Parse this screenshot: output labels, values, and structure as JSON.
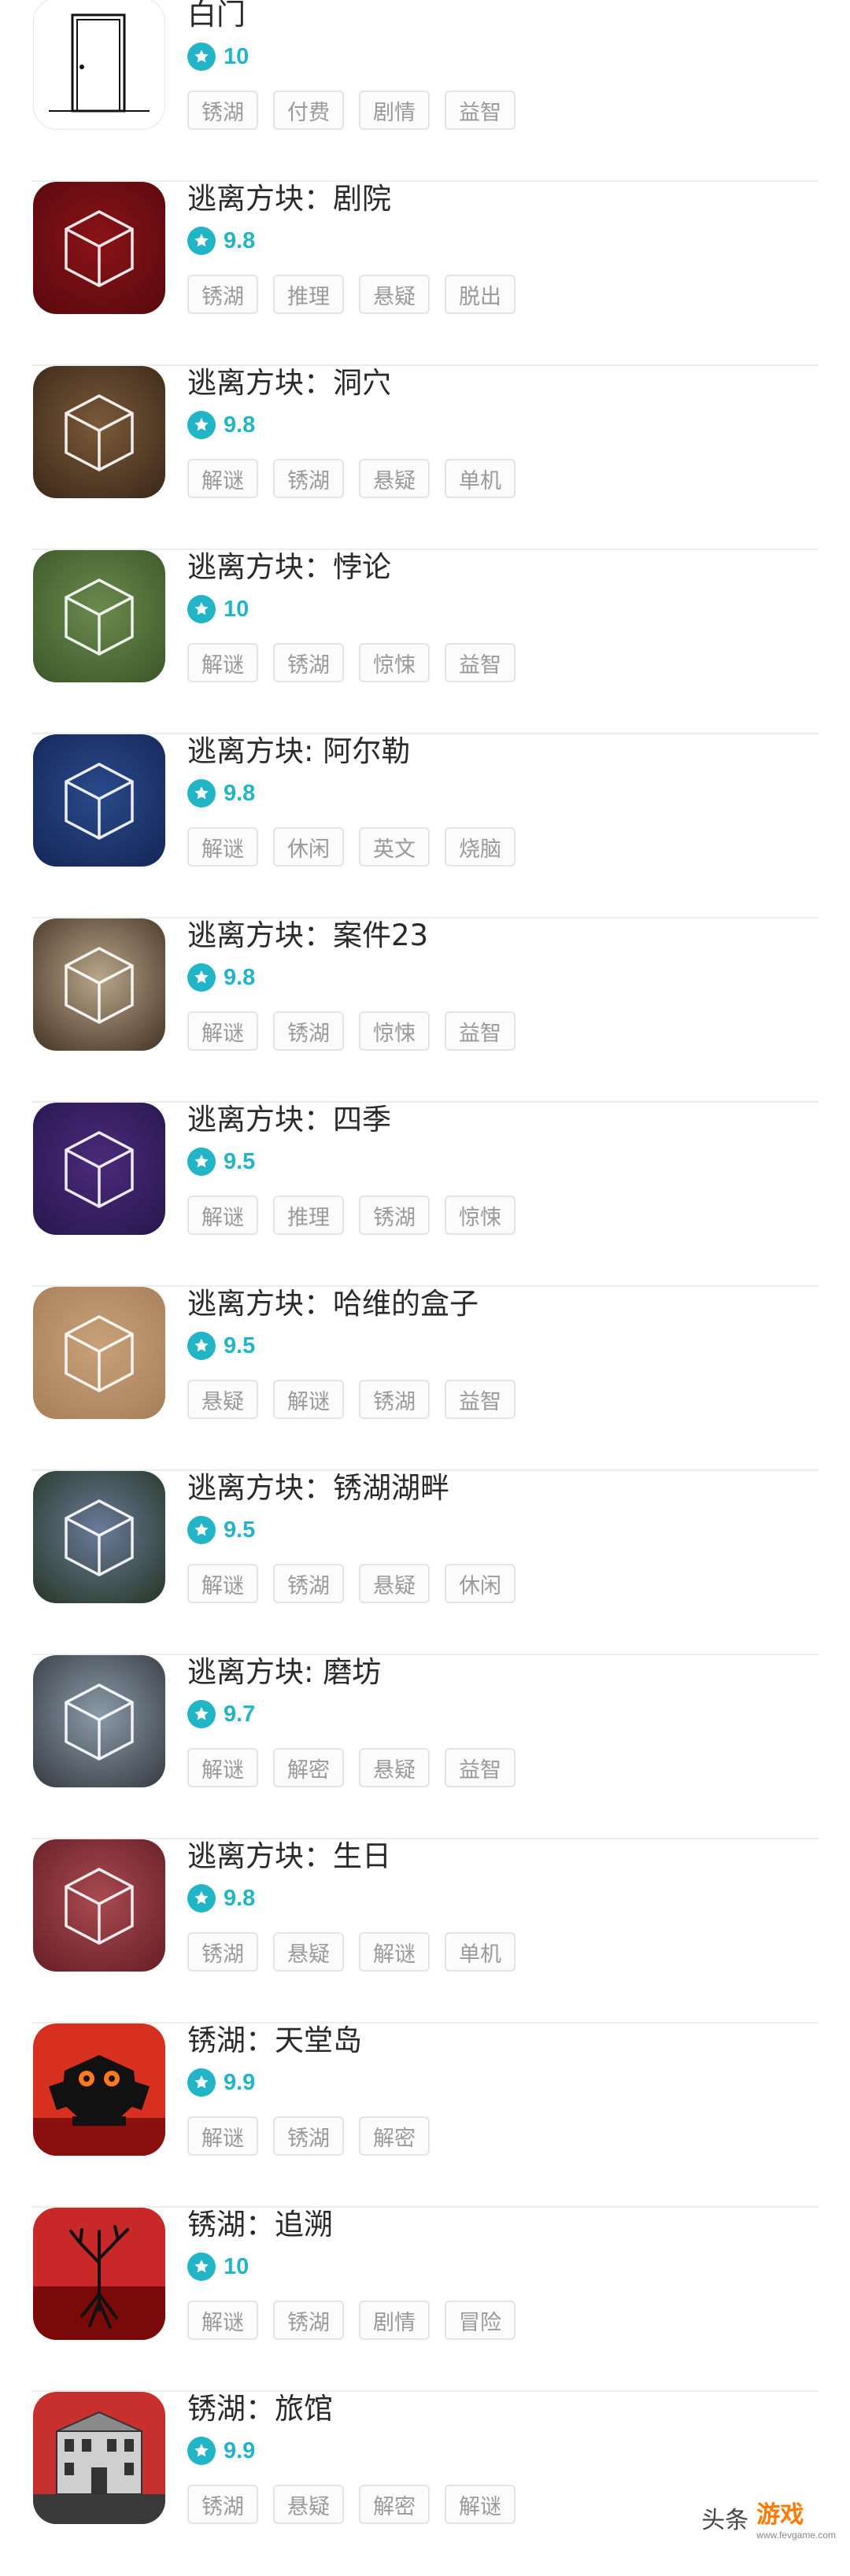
{
  "colors": {
    "accent": "#22b5c6",
    "title": "#2a2a2a",
    "tag_text": "#9a9a9a",
    "tag_border": "#e4e4e4",
    "divider": "#ededed"
  },
  "games": [
    {
      "title": "白门",
      "score": "10",
      "tags": [
        "锈湖",
        "付费",
        "剧情",
        "益智"
      ],
      "icon": "white-door-icon",
      "palette": [
        "#ffffff",
        "#f2f2f2"
      ]
    },
    {
      "title": "逃离方块：剧院",
      "score": "9.8",
      "tags": [
        "锈湖",
        "推理",
        "悬疑",
        "脱出"
      ],
      "icon": "cube-theatre-icon",
      "palette": [
        "#8a1318",
        "#5a0a0e"
      ]
    },
    {
      "title": "逃离方块：洞穴",
      "score": "9.8",
      "tags": [
        "解谜",
        "锈湖",
        "悬疑",
        "单机"
      ],
      "icon": "cube-cave-icon",
      "palette": [
        "#7a5a3a",
        "#3e2a1a"
      ]
    },
    {
      "title": "逃离方块：悖论",
      "score": "10",
      "tags": [
        "解谜",
        "锈湖",
        "惊悚",
        "益智"
      ],
      "icon": "cube-paradox-icon",
      "palette": [
        "#6b8a4e",
        "#3d5a2a"
      ]
    },
    {
      "title": "逃离方块: 阿尔勒",
      "score": "9.8",
      "tags": [
        "解谜",
        "休闲",
        "英文",
        "烧脑"
      ],
      "icon": "cube-arles-icon",
      "palette": [
        "#2a4a8a",
        "#15285a"
      ]
    },
    {
      "title": "逃离方块：案件23",
      "score": "9.8",
      "tags": [
        "解谜",
        "锈湖",
        "惊悚",
        "益智"
      ],
      "icon": "cube-case23-icon",
      "palette": [
        "#b8a58a",
        "#4a3a2a"
      ]
    },
    {
      "title": "逃离方块：四季",
      "score": "9.5",
      "tags": [
        "解谜",
        "推理",
        "锈湖",
        "惊悚"
      ],
      "icon": "cube-seasons-icon",
      "palette": [
        "#4a2a7a",
        "#2a1850"
      ]
    },
    {
      "title": "逃离方块：哈维的盒子",
      "score": "9.5",
      "tags": [
        "悬疑",
        "解谜",
        "锈湖",
        "益智"
      ],
      "icon": "cube-harveys-box-icon",
      "palette": [
        "#c8a07a",
        "#a8805a"
      ]
    },
    {
      "title": "逃离方块：锈湖湖畔",
      "score": "9.5",
      "tags": [
        "解谜",
        "锈湖",
        "悬疑",
        "休闲"
      ],
      "icon": "cube-lake-icon",
      "palette": [
        "#6a7a9a",
        "#2a3a2a"
      ]
    },
    {
      "title": "逃离方块: 磨坊",
      "score": "9.7",
      "tags": [
        "解谜",
        "解密",
        "悬疑",
        "益智"
      ],
      "icon": "cube-mill-icon",
      "palette": [
        "#8a9aa8",
        "#3a4048"
      ]
    },
    {
      "title": "逃离方块：生日",
      "score": "9.8",
      "tags": [
        "锈湖",
        "悬疑",
        "解谜",
        "单机"
      ],
      "icon": "cube-birthday-icon",
      "palette": [
        "#a84a50",
        "#6a2028"
      ]
    },
    {
      "title": "锈湖：天堂岛",
      "score": "9.9",
      "tags": [
        "解谜",
        "锈湖",
        "解密"
      ],
      "icon": "owl-paradise-icon",
      "palette": [
        "#d83020",
        "#8a1010"
      ]
    },
    {
      "title": "锈湖：追溯",
      "score": "10",
      "tags": [
        "解谜",
        "锈湖",
        "剧情",
        "冒险"
      ],
      "icon": "tree-roots-icon",
      "palette": [
        "#c82828",
        "#7a0a0a"
      ]
    },
    {
      "title": "锈湖：旅馆",
      "score": "9.9",
      "tags": [
        "锈湖",
        "悬疑",
        "解密",
        "解谜"
      ],
      "icon": "hotel-icon",
      "palette": [
        "#c83030",
        "#6a6a6a"
      ]
    }
  ],
  "watermark": {
    "text": "头条",
    "logo_main": "游戏",
    "logo_url": "www.fevgame.com"
  }
}
